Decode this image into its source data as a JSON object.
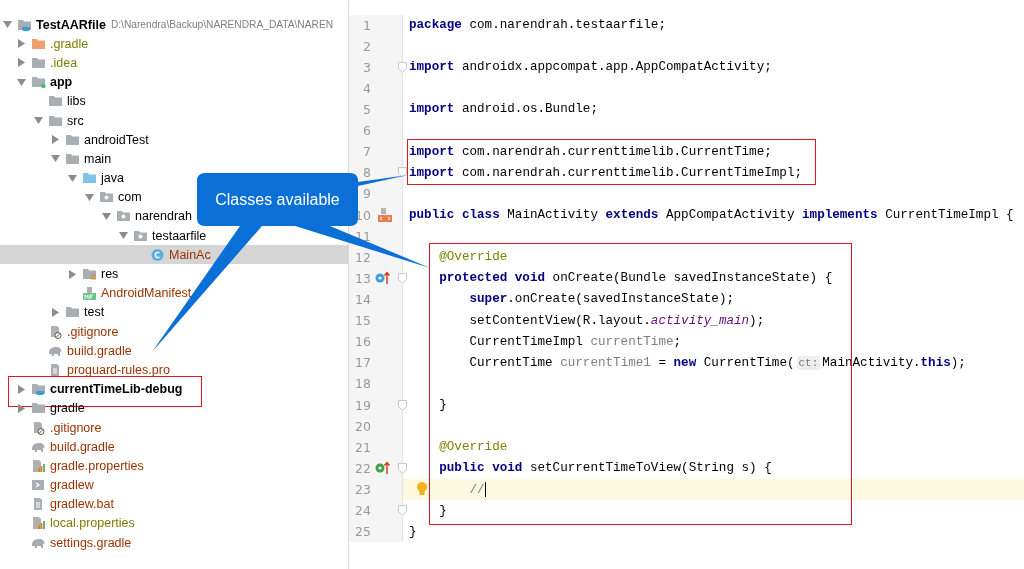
{
  "project_tree": {
    "label": "TestAARfile",
    "path": "D:\\Narendra\\Backup\\NARENDRA_DATA\\NAREN",
    "kind": "project",
    "ignored": false,
    "untracked": false,
    "expanded": true,
    "selected": false,
    "children": [
      {
        "label": ".gradle",
        "kind": "folder-excluded",
        "ignored": true,
        "untracked": false,
        "boxed": false,
        "expanded": false,
        "selected": false
      },
      {
        "label": ".idea",
        "kind": "folder",
        "ignored": true,
        "untracked": false,
        "boxed": false,
        "expanded": false,
        "selected": false
      },
      {
        "label": "app",
        "kind": "module",
        "ignored": false,
        "untracked": false,
        "boxed": false,
        "expanded": true,
        "selected": false,
        "children": [
          {
            "label": "libs",
            "kind": "folder",
            "ignored": false,
            "untracked": false,
            "boxed": false,
            "selected": false
          },
          {
            "label": "src",
            "kind": "folder",
            "ignored": false,
            "untracked": false,
            "boxed": false,
            "expanded": true,
            "selected": false,
            "children": [
              {
                "label": "androidTest",
                "kind": "folder",
                "ignored": false,
                "untracked": false,
                "boxed": false,
                "expanded": false,
                "selected": false
              },
              {
                "label": "main",
                "kind": "folder",
                "ignored": false,
                "untracked": false,
                "boxed": false,
                "expanded": true,
                "selected": false,
                "children": [
                  {
                    "label": "java",
                    "kind": "folder-source",
                    "ignored": false,
                    "untracked": false,
                    "boxed": false,
                    "expanded": true,
                    "selected": false,
                    "children": [
                      {
                        "label": "com",
                        "kind": "package",
                        "ignored": false,
                        "untracked": false,
                        "boxed": false,
                        "expanded": true,
                        "selected": false,
                        "children": [
                          {
                            "label": "narendrah",
                            "kind": "package",
                            "ignored": false,
                            "untracked": false,
                            "boxed": false,
                            "expanded": true,
                            "selected": false,
                            "children": [
                              {
                                "label": "testaarfile",
                                "kind": "package",
                                "ignored": false,
                                "untracked": false,
                                "boxed": false,
                                "expanded": true,
                                "selected": false,
                                "children": [
                                  {
                                    "label": "MainAc",
                                    "kind": "class",
                                    "ignored": false,
                                    "untracked": true,
                                    "boxed": false,
                                    "selected": true
                                  }
                                ]
                              }
                            ]
                          }
                        ]
                      }
                    ]
                  },
                  {
                    "label": "res",
                    "kind": "folder-res",
                    "ignored": false,
                    "untracked": false,
                    "boxed": false,
                    "expanded": false,
                    "selected": false
                  },
                  {
                    "label": "AndroidManifest",
                    "kind": "manifest",
                    "ignored": false,
                    "untracked": true,
                    "boxed": false,
                    "selected": false
                  }
                ]
              },
              {
                "label": "test",
                "kind": "folder",
                "ignored": false,
                "untracked": false,
                "boxed": false,
                "expanded": false,
                "selected": false
              }
            ]
          },
          {
            "label": ".gitignore",
            "kind": "gitignore",
            "ignored": false,
            "untracked": true,
            "boxed": false,
            "selected": false
          },
          {
            "label": "build.gradle",
            "kind": "gradle",
            "ignored": false,
            "untracked": true,
            "boxed": false,
            "selected": false
          },
          {
            "label": "proguard-rules.pro",
            "kind": "text",
            "ignored": false,
            "untracked": true,
            "boxed": false,
            "selected": false
          }
        ]
      },
      {
        "label": "currentTimeLib-debug",
        "kind": "project",
        "ignored": false,
        "untracked": false,
        "boxed": true,
        "expanded": false,
        "selected": false
      },
      {
        "label": "gradle",
        "kind": "folder",
        "ignored": false,
        "untracked": false,
        "boxed": false,
        "expanded": false,
        "selected": false
      },
      {
        "label": ".gitignore",
        "kind": "gitignore",
        "ignored": false,
        "untracked": true,
        "boxed": false,
        "selected": false
      },
      {
        "label": "build.gradle",
        "kind": "gradle",
        "ignored": false,
        "untracked": true,
        "boxed": false,
        "selected": false
      },
      {
        "label": "gradle.properties",
        "kind": "properties",
        "ignored": false,
        "untracked": true,
        "boxed": false,
        "selected": false
      },
      {
        "label": "gradlew",
        "kind": "script",
        "ignored": false,
        "untracked": true,
        "boxed": false,
        "selected": false
      },
      {
        "label": "gradlew.bat",
        "kind": "text",
        "ignored": false,
        "untracked": true,
        "boxed": false,
        "selected": false
      },
      {
        "label": "local.properties",
        "kind": "properties",
        "ignored": true,
        "untracked": false,
        "boxed": false,
        "selected": false
      },
      {
        "label": "settings.gradle",
        "kind": "gradle",
        "ignored": false,
        "untracked": true,
        "boxed": false,
        "selected": false
      }
    ]
  },
  "editor": {
    "lines": [
      {
        "number": "1",
        "kind": "plain",
        "boxed": false,
        "current": false,
        "tokens": [
          {
            "kind": "keyword",
            "text": "package"
          },
          {
            "kind": "plain",
            "text": " com.narendrah.testaarfile;"
          }
        ]
      },
      {
        "number": "2",
        "kind": "plain",
        "boxed": false,
        "current": false
      },
      {
        "number": "3",
        "kind": "fold",
        "boxed": false,
        "current": false,
        "tokens": [
          {
            "kind": "keyword",
            "text": "import"
          },
          {
            "kind": "plain",
            "text": " androidx.appcompat.app.AppCompatActivity;"
          }
        ]
      },
      {
        "number": "4",
        "kind": "plain",
        "boxed": false,
        "current": false
      },
      {
        "number": "5",
        "kind": "plain",
        "boxed": false,
        "current": false,
        "tokens": [
          {
            "kind": "keyword",
            "text": "import"
          },
          {
            "kind": "plain",
            "text": " android.os.Bundle;"
          }
        ]
      },
      {
        "number": "6",
        "kind": "plain",
        "boxed": false,
        "current": false
      },
      {
        "number": "7",
        "kind": "plain",
        "boxed": true,
        "current": false,
        "tokens": [
          {
            "kind": "keyword",
            "text": "import"
          },
          {
            "kind": "plain",
            "text": " com.narendrah.currenttimelib.CurrentTime;"
          }
        ]
      },
      {
        "number": "8",
        "kind": "fold",
        "boxed": true,
        "current": false,
        "tokens": [
          {
            "kind": "keyword",
            "text": "import"
          },
          {
            "kind": "plain",
            "text": " com.narendrah.currenttimelib.CurrentTimeImpl;"
          }
        ]
      },
      {
        "number": "9",
        "kind": "plain",
        "boxed": false,
        "current": false
      },
      {
        "number": "10",
        "kind": "class",
        "boxed": false,
        "current": false,
        "tokens": [
          {
            "kind": "keyword",
            "text": "public class"
          },
          {
            "kind": "plain",
            "text": " MainActivity "
          },
          {
            "kind": "keyword",
            "text": "extends"
          },
          {
            "kind": "plain",
            "text": " AppCompatActivity "
          },
          {
            "kind": "keyword",
            "text": "implements"
          },
          {
            "kind": "plain",
            "text": " CurrentTimeImpl {"
          }
        ]
      },
      {
        "number": "11",
        "kind": "plain",
        "boxed": false,
        "current": false
      },
      {
        "number": "12",
        "kind": "plain",
        "boxed": true,
        "current": false,
        "tokens": [
          {
            "kind": "annotation",
            "text": "    @Override"
          }
        ]
      },
      {
        "number": "13",
        "kind": "override",
        "boxed": true,
        "current": false,
        "tokens": [
          {
            "kind": "keyword",
            "text": "    protected void"
          },
          {
            "kind": "plain",
            "text": " onCreate(Bundle savedInstanceState) {"
          }
        ]
      },
      {
        "number": "14",
        "kind": "plain",
        "boxed": true,
        "current": false,
        "tokens": [
          {
            "kind": "keyword",
            "text": "        super"
          },
          {
            "kind": "plain",
            "text": ".onCreate(savedInstanceState);"
          }
        ]
      },
      {
        "number": "15",
        "kind": "plain",
        "boxed": true,
        "current": false,
        "tokens": [
          {
            "kind": "plain",
            "text": "        setContentView(R.layout."
          },
          {
            "kind": "field",
            "text": "activity_main"
          },
          {
            "kind": "plain",
            "text": ");"
          }
        ]
      },
      {
        "number": "16",
        "kind": "plain",
        "boxed": true,
        "current": false,
        "tokens": [
          {
            "kind": "plain",
            "text": "        CurrentTimeImpl "
          },
          {
            "kind": "unused",
            "text": "currentTime"
          },
          {
            "kind": "plain",
            "text": ";"
          }
        ]
      },
      {
        "number": "17",
        "kind": "plain",
        "boxed": true,
        "current": false,
        "tokens": [
          {
            "kind": "plain",
            "text": "        CurrentTime "
          },
          {
            "kind": "unused",
            "text": "currentTime1"
          },
          {
            "kind": "plain",
            "text": " = "
          },
          {
            "kind": "keyword",
            "text": "new"
          },
          {
            "kind": "plain",
            "text": " CurrentTime("
          },
          {
            "kind": "hint",
            "text": "ct:"
          },
          {
            "kind": "plain",
            "text": "MainActivity."
          },
          {
            "kind": "keyword",
            "text": "this"
          },
          {
            "kind": "plain",
            "text": ");"
          }
        ]
      },
      {
        "number": "18",
        "kind": "plain",
        "boxed": true,
        "current": false
      },
      {
        "number": "19",
        "kind": "fold",
        "boxed": true,
        "current": false,
        "tokens": [
          {
            "kind": "plain",
            "text": "    }"
          }
        ]
      },
      {
        "number": "20",
        "kind": "plain",
        "boxed": true,
        "current": false
      },
      {
        "number": "21",
        "kind": "plain",
        "boxed": true,
        "current": false,
        "tokens": [
          {
            "kind": "annotation",
            "text": "    @Override"
          }
        ]
      },
      {
        "number": "22",
        "kind": "implements",
        "boxed": true,
        "current": false,
        "tokens": [
          {
            "kind": "keyword",
            "text": "    public void"
          },
          {
            "kind": "plain",
            "text": " setCurrentTimeToView(String s) {"
          }
        ]
      },
      {
        "number": "23",
        "kind": "plain",
        "boxed": true,
        "current": true,
        "tokens": [
          {
            "kind": "comment",
            "text": "        //"
          }
        ]
      },
      {
        "number": "24",
        "kind": "fold",
        "boxed": true,
        "current": false,
        "tokens": [
          {
            "kind": "plain",
            "text": "    }"
          }
        ]
      },
      {
        "number": "25",
        "kind": "plain",
        "boxed": false,
        "current": false,
        "tokens": [
          {
            "kind": "plain",
            "text": "}"
          }
        ]
      }
    ]
  },
  "callout": {
    "text": "Classes available"
  }
}
